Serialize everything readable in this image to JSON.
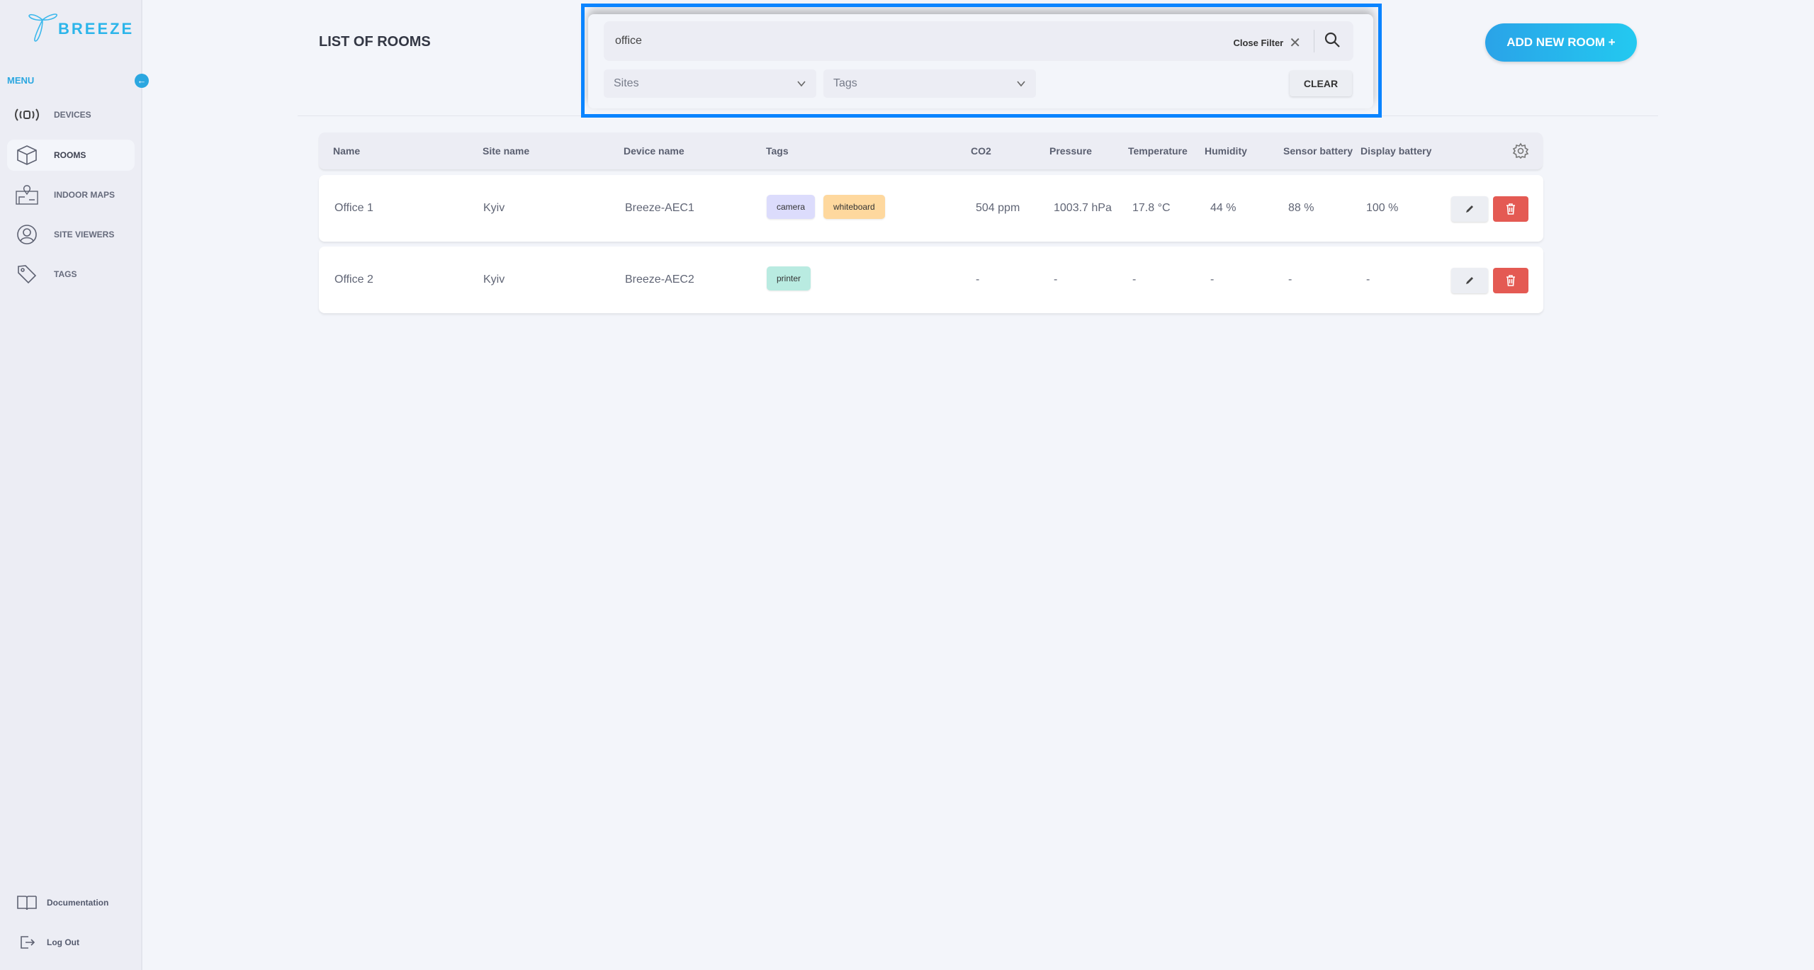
{
  "app": {
    "logo_text": "BREEZE",
    "brand_color": "#2cb5ea"
  },
  "sidebar": {
    "menu_label": "MENU",
    "collapse_icon": "arrow-left-icon",
    "items": [
      {
        "label": "DEVICES",
        "icon": "broadcast-icon",
        "active": false
      },
      {
        "label": "ROOMS",
        "icon": "cube-icon",
        "active": true
      },
      {
        "label": "INDOOR MAPS",
        "icon": "map-pin-icon",
        "active": false
      },
      {
        "label": "SITE VIEWERS",
        "icon": "user-circle-icon",
        "active": false
      },
      {
        "label": "TAGS",
        "icon": "tag-icon",
        "active": false
      }
    ],
    "footer": [
      {
        "label": "Documentation",
        "icon": "book-icon"
      },
      {
        "label": "Log Out",
        "icon": "logout-icon"
      }
    ]
  },
  "page": {
    "title": "LIST OF ROOMS",
    "add_button": "ADD NEW ROOM +"
  },
  "filter": {
    "search_value": "office",
    "close_filter": "Close Filter",
    "sites_placeholder": "Sites",
    "tags_placeholder": "Tags",
    "clear": "CLEAR"
  },
  "table": {
    "headers": [
      "Name",
      "Site name",
      "Device name",
      "Tags",
      "CO2",
      "Pressure",
      "Temperature",
      "Humidity",
      "Sensor battery",
      "Display battery"
    ],
    "rows": [
      {
        "name": "Office 1",
        "site": "Kyiv",
        "device": "Breeze-AEC1",
        "tags": [
          {
            "label": "camera",
            "color": "#dcdcfc"
          },
          {
            "label": "whiteboard",
            "color": "#fed89e"
          }
        ],
        "co2": "504 ppm",
        "pressure": "1003.7 hPa",
        "temperature": "17.8 °C",
        "humidity": "44 %",
        "sensor_battery": "88 %",
        "display_battery": "100 %"
      },
      {
        "name": "Office 2",
        "site": "Kyiv",
        "device": "Breeze-AEC2",
        "tags": [
          {
            "label": "printer",
            "color": "#b9ebe1"
          }
        ],
        "co2": "-",
        "pressure": "-",
        "temperature": "-",
        "humidity": "-",
        "sensor_battery": "-",
        "display_battery": "-"
      }
    ]
  }
}
